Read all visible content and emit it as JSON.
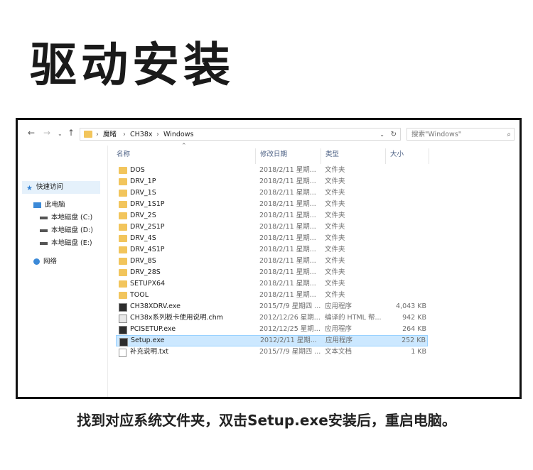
{
  "title": "驱动安装",
  "window": {
    "breadcrumb": [
      "魔睹",
      "CH38x",
      "Windows"
    ],
    "search_placeholder": "搜索\"Windows\"",
    "columns": {
      "name": "名称",
      "date": "修改日期",
      "type": "类型",
      "size": "大小"
    },
    "sidebar": [
      {
        "label": "快速访问",
        "icon": "star-icon"
      },
      {
        "label": "此电脑",
        "icon": "computer-icon"
      },
      {
        "label": "本地磁盘 (C:)",
        "icon": "drive-icon"
      },
      {
        "label": "本地磁盘 (D:)",
        "icon": "drive-icon"
      },
      {
        "label": "本地磁盘 (E:)",
        "icon": "drive-icon"
      },
      {
        "label": "网络",
        "icon": "network-icon"
      }
    ],
    "files": [
      {
        "name": "DOS",
        "date": "2018/2/11 星期...",
        "type": "文件夹",
        "size": "",
        "icon": "folder-icon"
      },
      {
        "name": "DRV_1P",
        "date": "2018/2/11 星期...",
        "type": "文件夹",
        "size": "",
        "icon": "folder-icon"
      },
      {
        "name": "DRV_1S",
        "date": "2018/2/11 星期...",
        "type": "文件夹",
        "size": "",
        "icon": "folder-icon"
      },
      {
        "name": "DRV_1S1P",
        "date": "2018/2/11 星期...",
        "type": "文件夹",
        "size": "",
        "icon": "folder-icon"
      },
      {
        "name": "DRV_2S",
        "date": "2018/2/11 星期...",
        "type": "文件夹",
        "size": "",
        "icon": "folder-icon"
      },
      {
        "name": "DRV_2S1P",
        "date": "2018/2/11 星期...",
        "type": "文件夹",
        "size": "",
        "icon": "folder-icon"
      },
      {
        "name": "DRV_4S",
        "date": "2018/2/11 星期...",
        "type": "文件夹",
        "size": "",
        "icon": "folder-icon"
      },
      {
        "name": "DRV_4S1P",
        "date": "2018/2/11 星期...",
        "type": "文件夹",
        "size": "",
        "icon": "folder-icon"
      },
      {
        "name": "DRV_8S",
        "date": "2018/2/11 星期...",
        "type": "文件夹",
        "size": "",
        "icon": "folder-icon"
      },
      {
        "name": "DRV_28S",
        "date": "2018/2/11 星期...",
        "type": "文件夹",
        "size": "",
        "icon": "folder-icon"
      },
      {
        "name": "SETUPX64",
        "date": "2018/2/11 星期...",
        "type": "文件夹",
        "size": "",
        "icon": "folder-icon"
      },
      {
        "name": "TOOL",
        "date": "2018/2/11 星期...",
        "type": "文件夹",
        "size": "",
        "icon": "folder-icon"
      },
      {
        "name": "CH38XDRV.exe",
        "date": "2015/7/9 星期四 ...",
        "type": "应用程序",
        "size": "4,043 KB",
        "icon": "installer-icon"
      },
      {
        "name": "CH38x系列板卡使用说明.chm",
        "date": "2012/12/26 星期...",
        "type": "编译的 HTML 帮...",
        "size": "942 KB",
        "icon": "help-file-icon"
      },
      {
        "name": "PCISETUP.exe",
        "date": "2012/12/25 星期...",
        "type": "应用程序",
        "size": "264 KB",
        "icon": "exe-icon"
      },
      {
        "name": "Setup.exe",
        "date": "2012/2/11 星期...",
        "type": "应用程序",
        "size": "252 KB",
        "icon": "exe-icon",
        "selected": true
      },
      {
        "name": "补充说明.txt",
        "date": "2015/7/9 星期四 ...",
        "type": "文本文档",
        "size": "1 KB",
        "icon": "text-file-icon"
      }
    ]
  },
  "caption": "找到对应系统文件夹，双击Setup.exe安装后，重启电脑。",
  "colors": {
    "folder": "#f2c55c",
    "selection": "#cce8ff",
    "selection_border": "#99d1ff",
    "column_header": "#4d6185"
  }
}
